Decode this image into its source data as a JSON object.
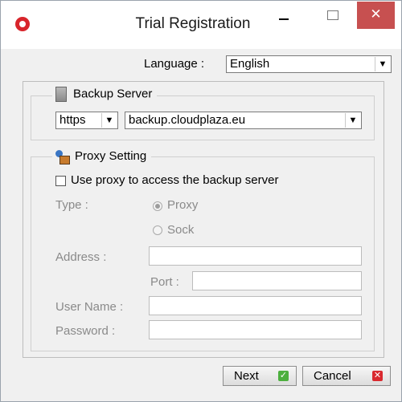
{
  "window": {
    "title": "Trial Registration",
    "close_symbol": "✕"
  },
  "language": {
    "label": "Language :",
    "value": "English"
  },
  "backup_server": {
    "legend": "Backup Server",
    "protocol": "https",
    "host": "backup.cloudplaza.eu"
  },
  "proxy": {
    "legend": "Proxy Setting",
    "use_proxy_label": "Use proxy to access the backup server",
    "type_label": "Type :",
    "option_proxy": "Proxy",
    "option_sock": "Sock",
    "address_label": "Address :",
    "port_label": "Port :",
    "username_label": "User Name :",
    "password_label": "Password :"
  },
  "buttons": {
    "next": "Next",
    "cancel": "Cancel"
  },
  "icons": {
    "app": "app-logo-icon",
    "server": "server-icon",
    "proxy": "proxy-icon",
    "next": "check-icon",
    "cancel": "x-icon"
  },
  "colors": {
    "brand": "#d8252b",
    "close_button": "#c75050",
    "ok_icon": "#4caf3e",
    "cancel_icon": "#d9292f"
  }
}
